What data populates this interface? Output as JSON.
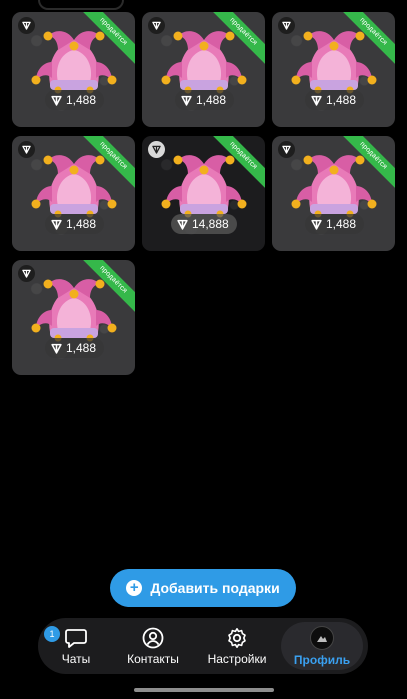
{
  "gifts": [
    {
      "price": "1,488",
      "ribbon": "продаётся",
      "variant": "normal"
    },
    {
      "price": "1,488",
      "ribbon": "продаётся",
      "variant": "normal"
    },
    {
      "price": "1,488",
      "ribbon": "продаётся",
      "variant": "normal"
    },
    {
      "price": "1,488",
      "ribbon": "продаётся",
      "variant": "normal"
    },
    {
      "price": "14,888",
      "ribbon": "продаётся",
      "variant": "dark"
    },
    {
      "price": "1,488",
      "ribbon": "продаётся",
      "variant": "normal"
    },
    {
      "price": "1,488",
      "ribbon": "продаётся",
      "variant": "normal"
    }
  ],
  "add_button": {
    "label": "Добавить подарки",
    "icon": "plus-circle-icon"
  },
  "tabs": [
    {
      "label": "Чаты",
      "icon": "chat-icon",
      "badge": "1"
    },
    {
      "label": "Контакты",
      "icon": "person-circle-icon"
    },
    {
      "label": "Настройки",
      "icon": "gear-icon"
    },
    {
      "label": "Профиль",
      "icon": "avatar",
      "active": true
    }
  ],
  "colors": {
    "accent": "#2f9be6",
    "ribbon": "#35b84a",
    "hat_pink": "#e87ab8",
    "bell": "#f2b01e"
  }
}
